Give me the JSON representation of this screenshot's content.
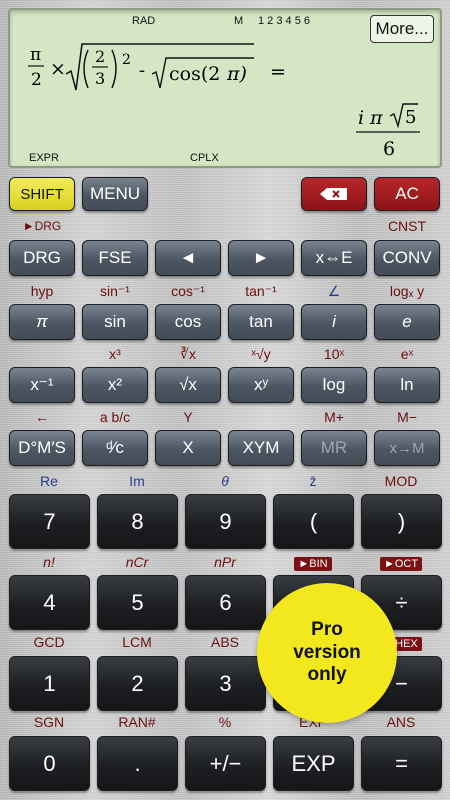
{
  "display": {
    "indicators": {
      "rad": "RAD",
      "m": "M",
      "digits": "1 2 3 4 5 6",
      "expr": "EXPR",
      "cplx": "CPLX"
    },
    "more_label": "More...",
    "expression": {
      "pi": "π",
      "two": "2",
      "times": "×",
      "frac_num": "2",
      "frac_den": "3",
      "exp": "2",
      "minus": "-",
      "cos": "cos(2",
      "pi2": "π)",
      "eq": "="
    },
    "result": {
      "num_i": "i",
      "num_pi": "π",
      "num_root": "5",
      "den": "6"
    }
  },
  "top": {
    "shift": "SHIFT",
    "menu": "MENU",
    "ac": "AC"
  },
  "labels": {
    "row1": [
      "►DRG",
      "",
      "",
      "",
      "",
      "CNST"
    ],
    "row2": [
      "hyp",
      "sin⁻¹",
      "cos⁻¹",
      "tan⁻¹",
      "∠",
      "logₓ y"
    ],
    "row3": [
      "",
      "x³",
      "∛x",
      "ˣ√y",
      "10ˣ",
      "eˣ"
    ],
    "row4": [
      "←",
      "a b/c",
      "Y",
      "",
      "M+",
      "M−"
    ],
    "row5": [
      "Re",
      "Im",
      "θ",
      "z̄",
      "MOD"
    ],
    "row6": [
      "n!",
      "nCr",
      "nPr",
      "►BIN",
      "►OCT"
    ],
    "row7": [
      "GCD",
      "LCM",
      "ABS",
      "",
      "►HEX"
    ],
    "row8": [
      "SGN",
      "RAN#",
      "%",
      "EXP",
      "ANS"
    ]
  },
  "keys": {
    "row1": [
      "DRG",
      "FSE",
      "◄",
      "►",
      "x⇔E",
      "CONV"
    ],
    "row2": [
      "π",
      "sin",
      "cos",
      "tan",
      "i",
      "e"
    ],
    "row3": [
      "x⁻¹",
      "x²",
      "√x",
      "xʸ",
      "log",
      "ln"
    ],
    "row4": [
      "D°M′S",
      "ᵈ⁄c",
      "X",
      "XYM",
      "MR",
      "x→M"
    ],
    "row5": [
      "7",
      "8",
      "9",
      "(",
      ")"
    ],
    "row6": [
      "4",
      "5",
      "6",
      "×",
      "÷"
    ],
    "row7": [
      "1",
      "2",
      "3",
      "+",
      "−"
    ],
    "row8": [
      "0",
      ".",
      "+/−",
      "EXP",
      "="
    ]
  },
  "promo": {
    "line1": "Pro",
    "line2": "version",
    "line3": "only"
  }
}
